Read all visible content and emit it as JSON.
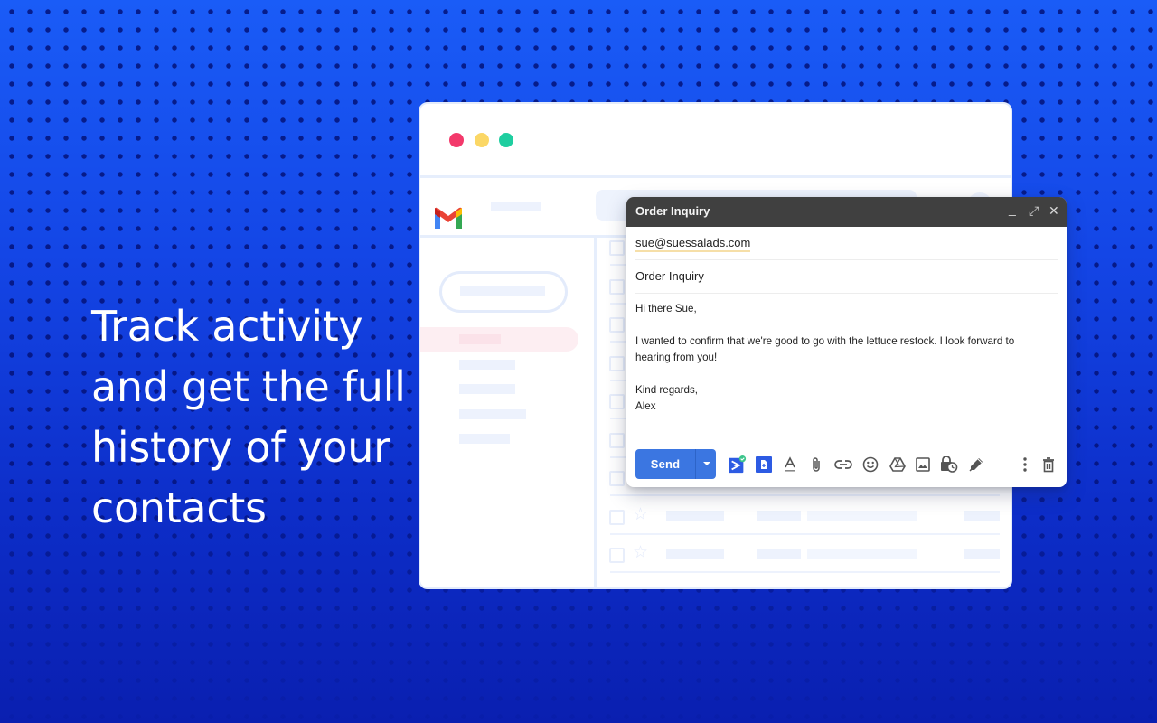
{
  "headline": {
    "lines": [
      "Track activity",
      "and get the full",
      "history of your",
      "contacts"
    ]
  },
  "window": {
    "traffic_lights": {
      "close": "#f3396b",
      "minimize": "#fbd766",
      "maximize": "#1fcea0"
    },
    "app_logo": "gmail-logo-icon",
    "list_rows": 9
  },
  "compose": {
    "title": "Order Inquiry",
    "controls": {
      "minimize": "_",
      "expand": "⤢",
      "close": "✕"
    },
    "to": "sue@suessalads.com",
    "subject": "Order Inquiry",
    "body": {
      "greeting": "Hi there Sue,",
      "paragraph": "I wanted to confirm that we're good to go with the lettuce restock. I look forward to hearing from you!",
      "closing": "Kind regards,",
      "signature": "Alex"
    },
    "toolbar": {
      "send_label": "Send",
      "accent": "#3b76e1",
      "icons": [
        "tracking-extension-icon",
        "template-extension-icon",
        "text-format-icon",
        "attach-icon",
        "link-icon",
        "emoji-icon",
        "drive-icon",
        "photo-icon",
        "confidential-mode-icon",
        "signature-icon",
        "more-options-icon",
        "delete-icon"
      ]
    }
  }
}
